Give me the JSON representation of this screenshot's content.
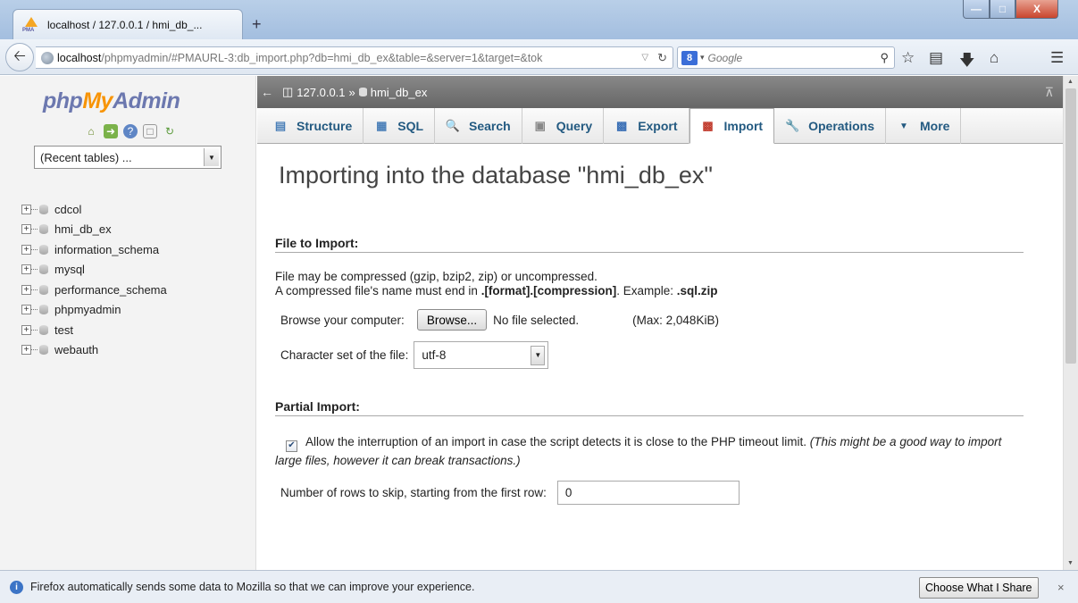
{
  "browser": {
    "tab_title": "localhost / 127.0.0.1 / hmi_db_...",
    "new_tab_symbol": "+",
    "url_host": "localhost",
    "url_path": "/phpmyadmin/#PMAURL-3:db_import.php?db=hmi_db_ex&table=&server=1&target=&tok",
    "search_engine": "Google",
    "window_buttons": {
      "minimize": "—",
      "maximize": "□",
      "close": "X"
    }
  },
  "sidebar": {
    "logo": {
      "php": "php",
      "my": "My",
      "admin": "Admin"
    },
    "icons": [
      "home-icon",
      "exit-icon",
      "help-icon",
      "docs-icon",
      "reload-icon"
    ],
    "recent_tables": "(Recent tables) ...",
    "databases": [
      "cdcol",
      "hmi_db_ex",
      "information_schema",
      "mysql",
      "performance_schema",
      "phpmyadmin",
      "test",
      "webauth"
    ]
  },
  "breadcrumb": {
    "server": "127.0.0.1",
    "separator": "»",
    "database": "hmi_db_ex"
  },
  "tabs": [
    {
      "label": "Structure",
      "icon": "structure-icon"
    },
    {
      "label": "SQL",
      "icon": "sql-icon"
    },
    {
      "label": "Search",
      "icon": "search-icon"
    },
    {
      "label": "Query",
      "icon": "query-icon"
    },
    {
      "label": "Export",
      "icon": "export-icon"
    },
    {
      "label": "Import",
      "icon": "import-icon",
      "active": true
    },
    {
      "label": "Operations",
      "icon": "wrench-icon"
    },
    {
      "label": "More",
      "icon": "triangle-down-icon"
    }
  ],
  "page": {
    "heading": "Importing into the database \"hmi_db_ex\"",
    "file_section": {
      "title": "File to Import:",
      "line1": "File may be compressed (gzip, bzip2, zip) or uncompressed.",
      "line2_prefix": "A compressed file's name must end in ",
      "line2_format": ".[format].[compression]",
      "line2_mid": ". Example: ",
      "line2_example": ".sql.zip",
      "browse_label": "Browse your computer:",
      "browse_button": "Browse...",
      "no_file": "No file selected.",
      "max_size": "(Max: 2,048KiB)",
      "charset_label": "Character set of the file:",
      "charset_value": "utf-8"
    },
    "partial_section": {
      "title": "Partial Import:",
      "allow_interrupt_checked": true,
      "allow_interrupt_text": "Allow the interruption of an import in case the script detects it is close to the PHP timeout limit.",
      "allow_interrupt_note": "(This might be a good way to import large files, however it can break transactions.)",
      "skip_label": "Number of rows to skip, starting from the first row:",
      "skip_value": "0"
    }
  },
  "notification": {
    "text": "Firefox automatically sends some data to Mozilla so that we can improve your experience.",
    "button": "Choose What I Share",
    "close": "×"
  }
}
